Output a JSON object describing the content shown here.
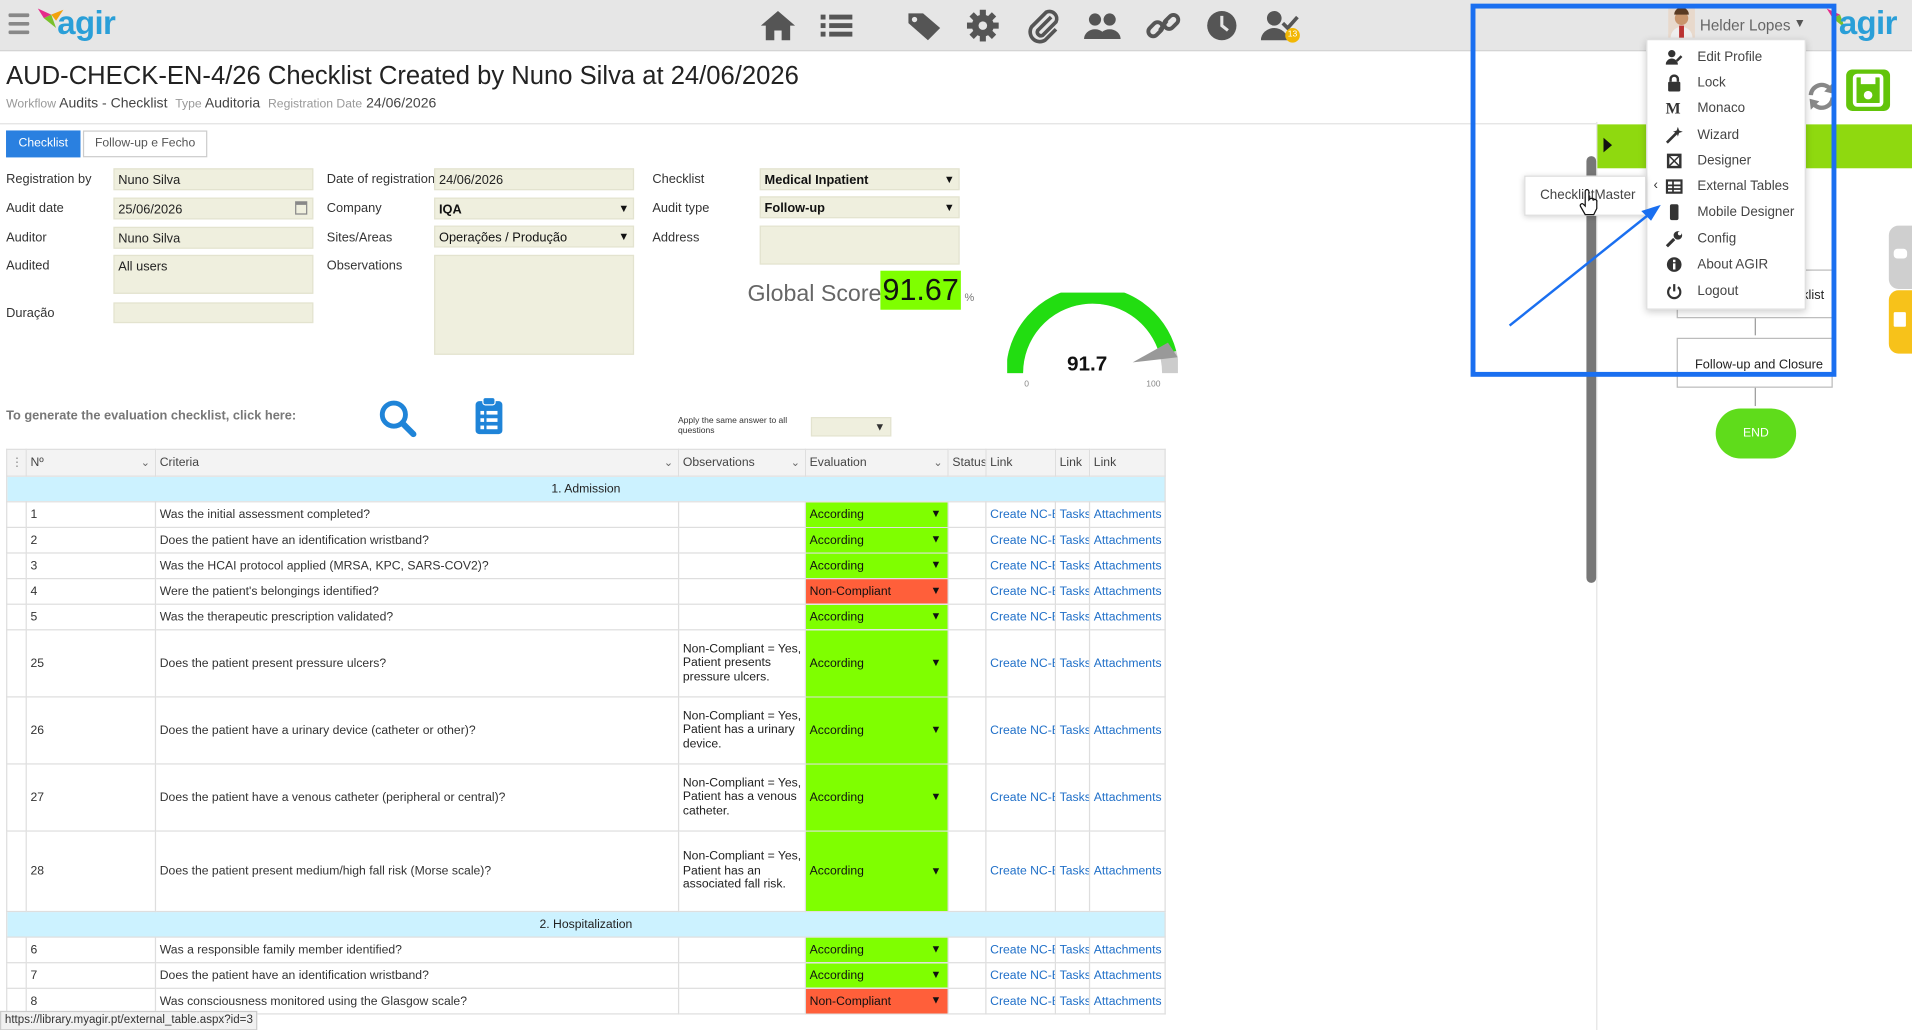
{
  "header": {
    "logo": "agir",
    "logo_right": "agir",
    "nav_icons": [
      "home-icon",
      "list-icon",
      "tags-icon",
      "gear-icon",
      "paperclip-icon",
      "users-icon",
      "link-icon",
      "clock-icon",
      "user-check-icon"
    ],
    "notification_badge": "13",
    "user_name": "Helder Lopes"
  },
  "page": {
    "title": "AUD-CHECK-EN-4/26 Checklist Created by Nuno Silva at 24/06/2026",
    "meta": {
      "workflow_label": "Workflow",
      "workflow_value": "Audits - Checklist",
      "type_label": "Type",
      "type_value": "Auditoria",
      "regdate_label": "Registration Date",
      "regdate_value": "24/06/2026"
    },
    "tabs": [
      "Checklist",
      "Follow-up e Fecho"
    ]
  },
  "form": {
    "registration_by_label": "Registration by",
    "registration_by": "Nuno Silva",
    "audit_date_label": "Audit date",
    "audit_date": "25/06/2026",
    "auditor_label": "Auditor",
    "auditor": "Nuno Silva",
    "audited_label": "Audited",
    "audited": "All users",
    "duracao_label": "Duração",
    "duracao": "",
    "date_reg_label": "Date of registration",
    "date_reg": "24/06/2026",
    "company_label": "Company",
    "company": "IQA",
    "sites_label": "Sites/Areas",
    "sites": "Operações / Produção",
    "observations_label": "Observations",
    "checklist_label": "Checklist",
    "checklist": "Medical Inpatient",
    "audit_type_label": "Audit type",
    "audit_type": "Follow-up",
    "address_label": "Address"
  },
  "score": {
    "label": "Global Score",
    "value": "91.67",
    "unit": "%",
    "gauge_value": "91.7",
    "gauge_fraction": 0.917,
    "gauge_min": "0",
    "gauge_max": "100"
  },
  "generate": {
    "label": "To generate the evaluation checklist, click here:",
    "apply_label": "Apply the same answer to all questions"
  },
  "table": {
    "headers": [
      "Nº",
      "Criteria",
      "Observations",
      "Evaluation",
      "Status",
      "Link",
      "Link",
      "Link"
    ],
    "sections": [
      {
        "title": "1. Admission",
        "rows": [
          {
            "n": "1",
            "criteria": "Was the initial assessment completed?",
            "obs": "",
            "eval": "According",
            "status": "ok"
          },
          {
            "n": "2",
            "criteria": "Does the patient have an identification wristband?",
            "obs": "",
            "eval": "According",
            "status": "ok"
          },
          {
            "n": "3",
            "criteria": "Was the HCAI protocol applied (MRSA, KPC, SARS-COV2)?",
            "obs": "",
            "eval": "According",
            "status": "ok"
          },
          {
            "n": "4",
            "criteria": "Were the patient's belongings identified?",
            "obs": "",
            "eval": "Non-Compliant",
            "status": "nc"
          },
          {
            "n": "5",
            "criteria": "Was the therapeutic prescription validated?",
            "obs": "",
            "eval": "According",
            "status": "ok"
          },
          {
            "n": "25",
            "criteria": "Does the patient present pressure ulcers?",
            "obs": "Non-Compliant = Yes, Patient presents pressure ulcers.",
            "eval": "According",
            "status": "ok"
          },
          {
            "n": "26",
            "criteria": "Does the patient have a urinary device (catheter or other)?",
            "obs": "Non-Compliant = Yes, Patient has a urinary device.",
            "eval": "According",
            "status": "ok"
          },
          {
            "n": "27",
            "criteria": "Does the patient have a venous catheter (peripheral or central)?",
            "obs": "Non-Compliant = Yes, Patient has a venous catheter.",
            "eval": "According",
            "status": "ok"
          },
          {
            "n": "28",
            "criteria": "Does the patient present medium/high fall risk (Morse scale)?",
            "obs": "Non-Compliant = Yes, Patient has an associated fall risk.",
            "eval": "According",
            "status": "ok"
          }
        ]
      },
      {
        "title": "2. Hospitalization",
        "rows": [
          {
            "n": "6",
            "criteria": "Was a responsible family member identified?",
            "obs": "",
            "eval": "According",
            "status": "ok"
          },
          {
            "n": "7",
            "criteria": "Does the patient have an identification wristband?",
            "obs": "",
            "eval": "According",
            "status": "ok"
          },
          {
            "n": "8",
            "criteria": "Was consciousness monitored using the Glasgow scale?",
            "obs": "",
            "eval": "Non-Compliant",
            "status": "nc"
          }
        ]
      }
    ],
    "link_texts": [
      "Create NC-E",
      "Tasks",
      "Attachments"
    ]
  },
  "status_url": "https://library.myagir.pt/external_table.aspx?id=3",
  "workflow_panel": {
    "box1": "klist",
    "box2": "Follow-up and Closure",
    "end": "END"
  },
  "user_menu": {
    "items": [
      {
        "label": "Edit Profile",
        "icon": "user-edit-icon"
      },
      {
        "label": "Lock",
        "icon": "lock-icon"
      },
      {
        "label": "Monaco",
        "icon": "monaco-m-icon"
      },
      {
        "label": "Wizard",
        "icon": "magic-wand-icon"
      },
      {
        "label": "Designer",
        "icon": "designer-icon"
      },
      {
        "label": "External Tables",
        "icon": "table-icon"
      },
      {
        "label": "Mobile Designer",
        "icon": "mobile-icon"
      },
      {
        "label": "Config",
        "icon": "wrench-icon"
      },
      {
        "label": "About AGIR",
        "icon": "info-icon"
      },
      {
        "label": "Logout",
        "icon": "power-icon"
      }
    ],
    "submenu_item": "ChecklistMaster"
  },
  "colors": {
    "accent_blue": "#2a80e0",
    "according_green": "#7fff00",
    "noncompliant_red": "#ff5f3a",
    "section_bg": "#ccf2ff",
    "highlight_frame": "#1a6ff0"
  }
}
